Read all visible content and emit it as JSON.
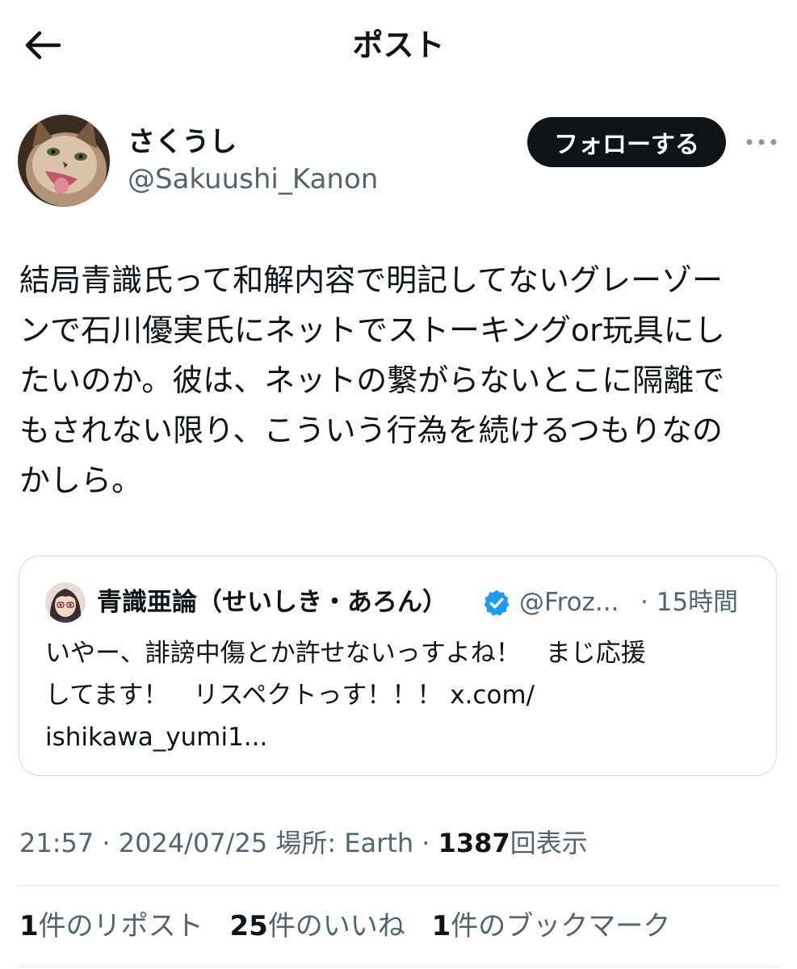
{
  "header": {
    "title": "ポスト"
  },
  "author": {
    "display_name": "さくうし",
    "handle": "@Sakuushi_Kanon",
    "follow_label": "フォローする"
  },
  "post": {
    "text": "結局青識氏って和解内容で明記してないグレーゾー\nンで石川優実氏にネットでストーキングor玩具にし\nたいのか。彼は、ネットの繋がらないとこに隔離で\nもされない限り、こういう行為を続けるつもりなの\nかしら。"
  },
  "quote": {
    "display_name": "青識亜論（せいしき・あろん）",
    "handle": "@Froz...",
    "separator": "·",
    "time": "15時間",
    "text": "いやー、誹謗中傷とか許せないっすよね！　まじ応援\nしてます！　リスペクトっす！！！ x.com/\nishikawa_yumi1..."
  },
  "meta": {
    "time": "21:57",
    "sep1": "·",
    "date": "2024/07/25",
    "location": "場所: Earth",
    "sep2": "·",
    "views_count": "1387",
    "views_label": "回表示"
  },
  "stats": {
    "reposts_count": "1",
    "reposts_label": "件のリポスト",
    "likes_count": "25",
    "likes_label": "件のいいね",
    "bookmarks_count": "1",
    "bookmarks_label": "件のブックマーク"
  },
  "colors": {
    "text": "#0f1419",
    "secondary": "#536471",
    "border": "#cfd9de",
    "verified": "#1d9bf0"
  },
  "icons": [
    "back-arrow-icon",
    "more-dots-icon",
    "verified-badge-icon"
  ]
}
